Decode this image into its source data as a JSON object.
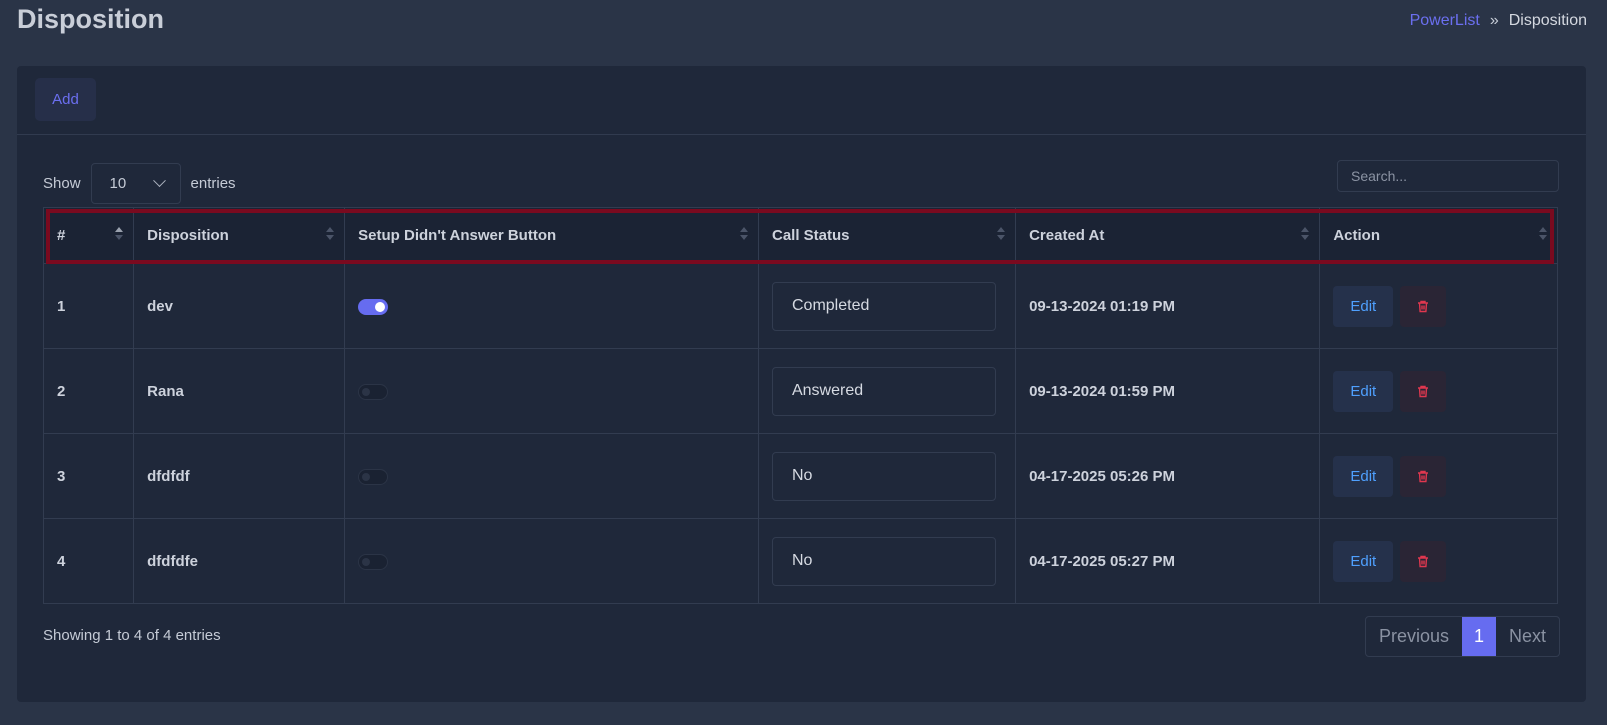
{
  "header": {
    "title": "Disposition",
    "breadcrumb": {
      "link": "PowerList",
      "separator": "»",
      "current": "Disposition"
    }
  },
  "toolbar": {
    "add_label": "Add"
  },
  "table_controls": {
    "show_label": "Show",
    "page_size": "10",
    "entries_label": "entries",
    "search_placeholder": "Search..."
  },
  "table": {
    "columns": [
      "#",
      "Disposition",
      "Setup Didn't Answer Button",
      "Call Status",
      "Created At",
      "Action"
    ],
    "rows": [
      {
        "num": "1",
        "disposition": "dev",
        "setup_on": true,
        "call_status": "Completed",
        "created_at": "09-13-2024 01:19 PM",
        "edit_label": "Edit"
      },
      {
        "num": "2",
        "disposition": "Rana",
        "setup_on": false,
        "call_status": "Answered",
        "created_at": "09-13-2024 01:59 PM",
        "edit_label": "Edit"
      },
      {
        "num": "3",
        "disposition": "dfdfdf",
        "setup_on": false,
        "call_status": "No",
        "created_at": "04-17-2025 05:26 PM",
        "edit_label": "Edit"
      },
      {
        "num": "4",
        "disposition": "dfdfdfe",
        "setup_on": false,
        "call_status": "No",
        "created_at": "04-17-2025 05:27 PM",
        "edit_label": "Edit"
      }
    ]
  },
  "footer": {
    "info": "Showing 1 to 4 of 4 entries",
    "previous_label": "Previous",
    "page": "1",
    "next_label": "Next"
  },
  "colors": {
    "accent": "#666cf0",
    "edit": "#4fa0ff",
    "delete": "#e0374f",
    "highlight": "#7a0a1f"
  },
  "icons": {
    "delete": "trash-icon",
    "dropdown": "chevron-down-icon",
    "sort": "sort-icon"
  }
}
